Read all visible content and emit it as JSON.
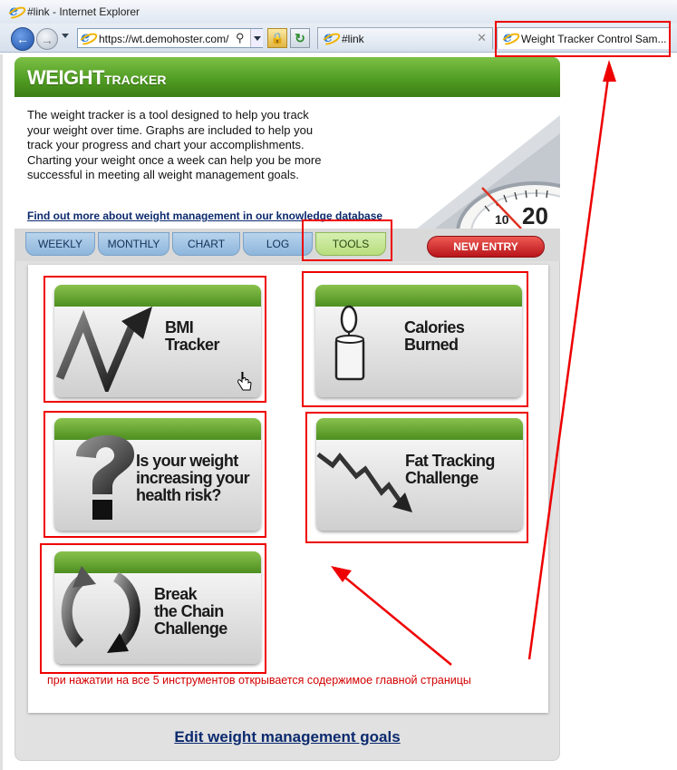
{
  "browser": {
    "window_title": "#link - Internet Explorer",
    "address": "https://wt.demohoster.com/",
    "tabs": [
      {
        "label": "#link"
      },
      {
        "label": "Weight Tracker Control Sam..."
      }
    ]
  },
  "app": {
    "logo_main": "WEIGHT",
    "logo_sub": "TRACKER",
    "intro": "The weight tracker is a tool designed to help you track your weight over time. Graphs are included to help you track your progress and chart your accomplishments. Charting your weight once a week can help you be more successful in meeting all weight management goals.",
    "intro_link": "Find out more about weight management in our knowledge database",
    "tabs": [
      {
        "label": "WEEKLY"
      },
      {
        "label": "MONTHLY"
      },
      {
        "label": "CHART"
      },
      {
        "label": "LOG"
      },
      {
        "label": "TOOLS",
        "active": true
      }
    ],
    "new_entry": "NEW ENTRY",
    "tools": [
      {
        "line1": "BMI",
        "line2": "Tracker",
        "icon": "zigzag-arrow-icon"
      },
      {
        "line1": "Calories",
        "line2": "Burned",
        "icon": "candle-icon"
      },
      {
        "line1": "Is your weight",
        "line2": "increasing your",
        "line3": "health risk?",
        "icon": "question-mark-icon"
      },
      {
        "line1": "Fat Tracking",
        "line2": "Challenge",
        "icon": "downtrend-arrow-icon"
      },
      {
        "line1": "Break",
        "line2": "the Chain",
        "line3": "Challenge",
        "icon": "cycle-arrows-icon"
      }
    ],
    "edit_goals": "Edit weight management goals"
  },
  "annotation": {
    "text": "при нажатии на все 5 инструментов открывается содержимое главной страницы",
    "color": "#dd0000"
  },
  "colors": {
    "header_green": "#4e9a21",
    "tab_blue": "#8db6dc",
    "tab_active": "#b7de7d",
    "new_entry_red": "#b8141a",
    "annotation_red": "#dd0000"
  }
}
